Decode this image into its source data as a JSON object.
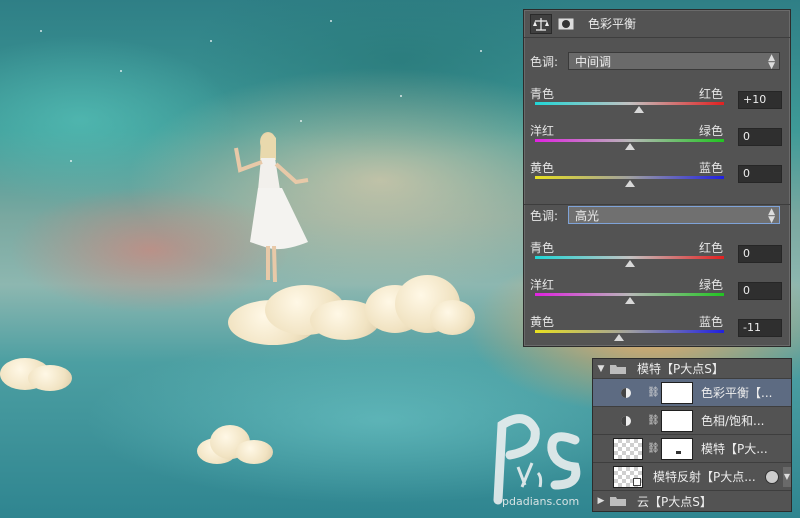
{
  "properties": {
    "title": "色彩平衡",
    "midtones": {
      "tone_label": "色调:",
      "tone_value": "中间调",
      "sliders": [
        {
          "left": "青色",
          "right": "红色",
          "value": "+10",
          "level": 10
        },
        {
          "left": "洋红",
          "right": "绿色",
          "value": "0",
          "level": 0
        },
        {
          "left": "黄色",
          "right": "蓝色",
          "value": "0",
          "level": 0
        }
      ]
    },
    "highlights": {
      "tone_label": "色调:",
      "tone_value": "高光",
      "sliders": [
        {
          "left": "青色",
          "right": "红色",
          "value": "0",
          "level": 0
        },
        {
          "left": "洋红",
          "right": "绿色",
          "value": "0",
          "level": 0
        },
        {
          "left": "黄色",
          "right": "蓝色",
          "value": "-11",
          "level": -11
        }
      ]
    }
  },
  "layers": {
    "group_name": "模特【P大点S】",
    "rows": [
      {
        "name": "色彩平衡【...",
        "type": "adjustment",
        "visible": true,
        "selected": true
      },
      {
        "name": "色相/饱和...",
        "type": "adjustment",
        "visible": true,
        "selected": false
      },
      {
        "name": "模特【P大...",
        "type": "layer",
        "visible": false,
        "selected": false
      },
      {
        "name": "模特反射【P大点...",
        "type": "smart",
        "visible": false,
        "selected": false
      }
    ],
    "group2_name": "云【P大点S】"
  },
  "watermark": {
    "site": "pdadians.com"
  },
  "icons": {
    "balance": "scales-icon",
    "mask": "mask-icon",
    "folder": "folder-icon",
    "eye": "eye-icon",
    "link": "link-icon"
  }
}
